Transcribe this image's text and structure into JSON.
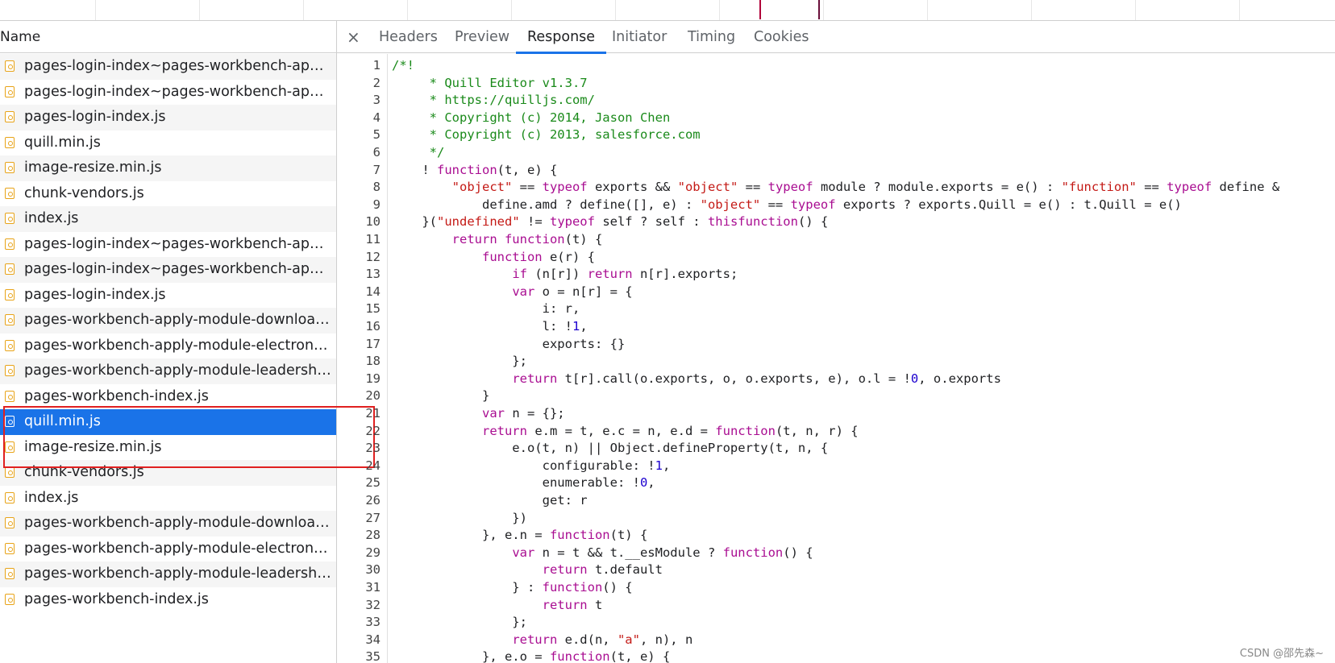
{
  "network_list": {
    "header": "Name",
    "items": [
      "pages-login-index~pages-workbench-apply-...",
      "pages-login-index~pages-workbench-apply-...",
      "pages-login-index.js",
      "quill.min.js",
      "image-resize.min.js",
      "chunk-vendors.js",
      "index.js",
      "pages-login-index~pages-workbench-apply-...",
      "pages-login-index~pages-workbench-apply-...",
      "pages-login-index.js",
      "pages-workbench-apply-module-downloadCe...",
      "pages-workbench-apply-module-electronicOf...",
      "pages-workbench-apply-module-leadershipA...",
      "pages-workbench-index.js",
      "quill.min.js",
      "image-resize.min.js",
      "chunk-vendors.js",
      "index.js",
      "pages-workbench-apply-module-downloadCe...",
      "pages-workbench-apply-module-electronicOf...",
      "pages-workbench-apply-module-leadershipA...",
      "pages-workbench-index.js"
    ],
    "selected_index": 14
  },
  "tabs": {
    "close": "×",
    "items": [
      "Headers",
      "Preview",
      "Response",
      "Initiator",
      "Timing",
      "Cookies"
    ],
    "active": "Response"
  },
  "code_lines": [
    [
      [
        "cm",
        "/*!"
      ]
    ],
    [
      [
        "cm",
        "     * Quill Editor v1.3.7"
      ]
    ],
    [
      [
        "cm",
        "     * https://quilljs.com/"
      ]
    ],
    [
      [
        "cm",
        "     * Copyright (c) 2014, Jason Chen"
      ]
    ],
    [
      [
        "cm",
        "     * Copyright (c) 2013, salesforce.com"
      ]
    ],
    [
      [
        "cm",
        "     */"
      ]
    ],
    [
      [
        "",
        "    ! "
      ],
      [
        "kw",
        "function"
      ],
      [
        "",
        "(t, e) {"
      ]
    ],
    [
      [
        "",
        "        "
      ],
      [
        "st",
        "\"object\""
      ],
      [
        "",
        " == "
      ],
      [
        "kw",
        "typeof"
      ],
      [
        "",
        " exports && "
      ],
      [
        "st",
        "\"object\""
      ],
      [
        "",
        " == "
      ],
      [
        "kw",
        "typeof"
      ],
      [
        "",
        " module ? module.exports = e() : "
      ],
      [
        "st",
        "\"function\""
      ],
      [
        "",
        " == "
      ],
      [
        "kw",
        "typeof"
      ],
      [
        "",
        " define &"
      ]
    ],
    [
      [
        "",
        "            define.amd ? define([], e) : "
      ],
      [
        "st",
        "\"object\""
      ],
      [
        "",
        " == "
      ],
      [
        "kw",
        "typeof"
      ],
      [
        "",
        " exports ? exports.Quill = e() : t.Quill = e()"
      ]
    ],
    [
      [
        "",
        "    }("
      ],
      [
        "st",
        "\"undefined\""
      ],
      [
        "",
        " != "
      ],
      [
        "kw",
        "typeof"
      ],
      [
        "",
        " self ? self : "
      ],
      [
        "kw",
        "this"
      ],
      [
        ", "
      ],
      [
        "kw",
        "function"
      ],
      [
        "",
        "() {"
      ]
    ],
    [
      [
        "",
        "        "
      ],
      [
        "kw",
        "return function"
      ],
      [
        "",
        "(t) {"
      ]
    ],
    [
      [
        "",
        "            "
      ],
      [
        "kw",
        "function"
      ],
      [
        "",
        " e(r) {"
      ]
    ],
    [
      [
        "",
        "                "
      ],
      [
        "kw",
        "if"
      ],
      [
        "",
        " (n[r]) "
      ],
      [
        "kw",
        "return"
      ],
      [
        "",
        " n[r].exports;"
      ]
    ],
    [
      [
        "",
        "                "
      ],
      [
        "kw",
        "var"
      ],
      [
        "",
        " o = n[r] = {"
      ]
    ],
    [
      [
        "",
        "                    i: r,"
      ]
    ],
    [
      [
        "",
        "                    l: !"
      ],
      [
        "nu",
        "1"
      ],
      [
        "",
        ","
      ]
    ],
    [
      [
        "",
        "                    exports: {}"
      ]
    ],
    [
      [
        "",
        "                };"
      ]
    ],
    [
      [
        "",
        "                "
      ],
      [
        "kw",
        "return"
      ],
      [
        "",
        " t[r].call(o.exports, o, o.exports, e), o.l = !"
      ],
      [
        "nu",
        "0"
      ],
      [
        "",
        ", o.exports"
      ]
    ],
    [
      [
        "",
        "            }"
      ]
    ],
    [
      [
        "",
        "            "
      ],
      [
        "kw",
        "var"
      ],
      [
        "",
        " n = {};"
      ]
    ],
    [
      [
        "",
        "            "
      ],
      [
        "kw",
        "return"
      ],
      [
        "",
        " e.m = t, e.c = n, e.d = "
      ],
      [
        "kw",
        "function"
      ],
      [
        "",
        "(t, n, r) {"
      ]
    ],
    [
      [
        "",
        "                e.o(t, n) || Object.defineProperty(t, n, {"
      ]
    ],
    [
      [
        "",
        "                    configurable: !"
      ],
      [
        "nu",
        "1"
      ],
      [
        "",
        ","
      ]
    ],
    [
      [
        "",
        "                    enumerable: !"
      ],
      [
        "nu",
        "0"
      ],
      [
        "",
        ","
      ]
    ],
    [
      [
        "",
        "                    get: r"
      ]
    ],
    [
      [
        "",
        "                })"
      ]
    ],
    [
      [
        "",
        "            }, e.n = "
      ],
      [
        "kw",
        "function"
      ],
      [
        "",
        "(t) {"
      ]
    ],
    [
      [
        "",
        "                "
      ],
      [
        "kw",
        "var"
      ],
      [
        "",
        " n = t && t.__esModule ? "
      ],
      [
        "kw",
        "function"
      ],
      [
        "",
        "() {"
      ]
    ],
    [
      [
        "",
        "                    "
      ],
      [
        "kw",
        "return"
      ],
      [
        "",
        " t.default"
      ]
    ],
    [
      [
        "",
        "                } : "
      ],
      [
        "kw",
        "function"
      ],
      [
        "",
        "() {"
      ]
    ],
    [
      [
        "",
        "                    "
      ],
      [
        "kw",
        "return"
      ],
      [
        "",
        " t"
      ]
    ],
    [
      [
        "",
        "                };"
      ]
    ],
    [
      [
        "",
        "                "
      ],
      [
        "kw",
        "return"
      ],
      [
        "",
        " e.d(n, "
      ],
      [
        "st",
        "\"a\""
      ],
      [
        "",
        ", n), n"
      ]
    ],
    [
      [
        "",
        "            }, e.o = "
      ],
      [
        "kw",
        "function"
      ],
      [
        "",
        "(t, e) {"
      ]
    ]
  ],
  "watermark": "CSDN @邵先森~"
}
